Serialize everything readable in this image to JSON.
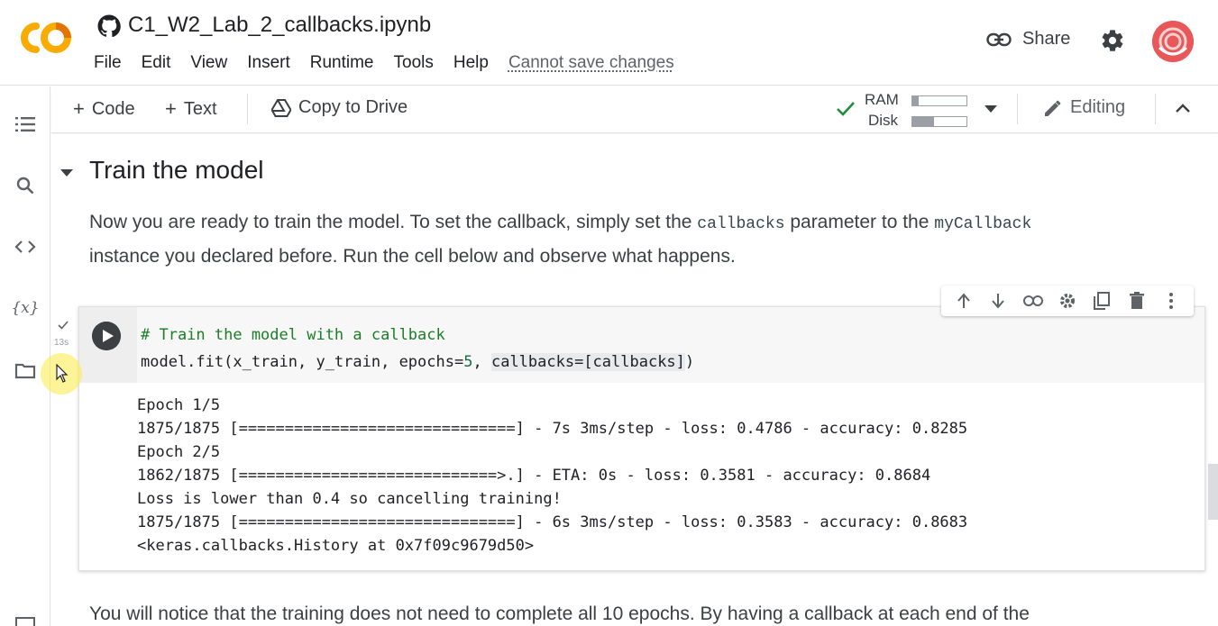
{
  "header": {
    "doc_title": "C1_W2_Lab_2_callbacks.ipynb",
    "menu": [
      "File",
      "Edit",
      "View",
      "Insert",
      "Runtime",
      "Tools",
      "Help"
    ],
    "cannot_save": "Cannot save changes",
    "share_label": "Share",
    "colors": {
      "logo_orange": "#f9ab00",
      "logo_dark": "#e37400",
      "avatar": "#e8585a"
    }
  },
  "sidebar": {
    "icons": [
      "table-of-contents-icon",
      "search-icon",
      "code-snippets-icon",
      "variables-icon",
      "files-icon",
      "terminal-icon"
    ]
  },
  "toolbar": {
    "add_code": "Code",
    "add_text": "Text",
    "copy_to_drive": "Copy to Drive",
    "ram_label": "RAM",
    "disk_label": "Disk",
    "ram_level": 0.12,
    "disk_level": 0.4,
    "editing_label": "Editing"
  },
  "content": {
    "section_title": "Train the model",
    "para1_line1_a": "Now you are ready to train the model. To set the callback, simply set the ",
    "para1_code1": "callbacks",
    "para1_line1_b": " parameter to the ",
    "para1_code2": "myCallback",
    "para1_line2": "instance you declared before. Run the cell below and observe what happens.",
    "exec_time": "13s",
    "code_comment": "# Train the model with a callback",
    "code_line2_a": "model.fit(x_train, y_train, epochs=",
    "code_line2_num": "5",
    "code_line2_b": ", ",
    "code_line2_hl": "callbacks=[callbacks]",
    "code_line2_c": ")",
    "output": [
      "Epoch 1/5",
      "1875/1875 [==============================] - 7s 3ms/step - loss: 0.4786 - accuracy: 0.8285",
      "Epoch 2/5",
      "1862/1875 [============================>.] - ETA: 0s - loss: 0.3581 - accuracy: 0.8684",
      "Loss is lower than 0.4 so cancelling training!",
      "1875/1875 [==============================] - 6s 3ms/step - loss: 0.3583 - accuracy: 0.8683",
      "<keras.callbacks.History at 0x7f09c9679d50>"
    ],
    "para2": "You will notice that the training does not need to complete all 10 epochs. By having a callback at each end of the"
  }
}
